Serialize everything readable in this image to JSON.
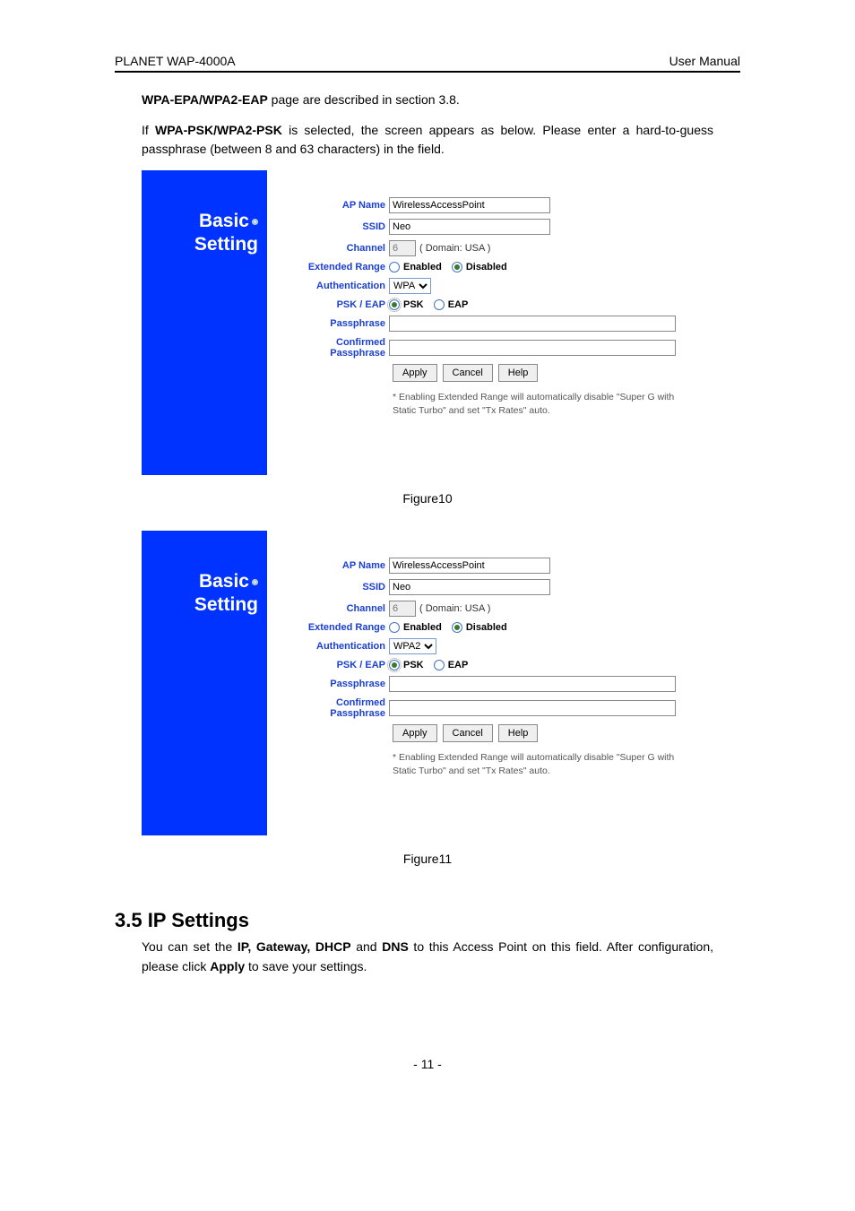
{
  "header": {
    "left": "PLANET WAP-4000A",
    "right": "User Manual"
  },
  "intro": {
    "p1a": "WPA-EPA/WPA2-EAP",
    "p1b": " page are described in section 3.8.",
    "p2a": "If ",
    "p2b": "WPA-PSK/WPA2-PSK",
    "p2c": " is selected, the screen appears as below. Please enter a hard-to-guess passphrase (between 8 and 63 characters) in the field."
  },
  "chart_data": [
    {
      "type": "table",
      "title": "Basic Setting form (WPA)",
      "fields": {
        "AP Name": "WirelessAccessPoint",
        "SSID": "Neo",
        "Channel": "6",
        "Channel_domain": "( Domain: USA )",
        "Extended Range": {
          "options": [
            "Enabled",
            "Disabled"
          ],
          "selected": "Disabled"
        },
        "Authentication": "WPA",
        "PSK / EAP": {
          "options": [
            "PSK",
            "EAP"
          ],
          "selected": "PSK"
        },
        "Passphrase": "",
        "Confirmed Passphrase": ""
      },
      "buttons": [
        "Apply",
        "Cancel",
        "Help"
      ],
      "footnote": "* Enabling Extended Range will automatically disable \"Super G with Static Turbo\" and set \"Tx Rates\" auto."
    },
    {
      "type": "table",
      "title": "Basic Setting form (WPA2)",
      "fields": {
        "AP Name": "WirelessAccessPoint",
        "SSID": "Neo",
        "Channel": "6",
        "Channel_domain": "( Domain: USA )",
        "Extended Range": {
          "options": [
            "Enabled",
            "Disabled"
          ],
          "selected": "Disabled"
        },
        "Authentication": "WPA2",
        "PSK / EAP": {
          "options": [
            "PSK",
            "EAP"
          ],
          "selected": "PSK"
        },
        "Passphrase": "",
        "Confirmed Passphrase": ""
      },
      "buttons": [
        "Apply",
        "Cancel",
        "Help"
      ],
      "footnote": "* Enabling Extended Range will automatically disable \"Super G with Static Turbo\" and set \"Tx Rates\" auto."
    }
  ],
  "panel": {
    "title1": "Basic",
    "title2": "Setting",
    "labels": {
      "apname": "AP Name",
      "ssid": "SSID",
      "channel": "Channel",
      "extrange": "Extended Range",
      "auth": "Authentication",
      "pskeap": "PSK / EAP",
      "pass": "Passphrase",
      "confirm": "Confirmed Passphrase",
      "enabled": "Enabled",
      "disabled": "Disabled",
      "psk": "PSK",
      "eap": "EAP"
    }
  },
  "captions": {
    "fig10": "Figure10",
    "fig11": "Figure11"
  },
  "section": {
    "heading": "3.5 IP Settings",
    "body_a": "You can set the ",
    "body_b": "IP, Gateway, DHCP",
    "body_c": " and ",
    "body_d": "DNS",
    "body_e": " to this Access Point on this field. After configuration, please click ",
    "body_f": "Apply",
    "body_g": " to save your settings."
  },
  "page_num": "- 11 -"
}
